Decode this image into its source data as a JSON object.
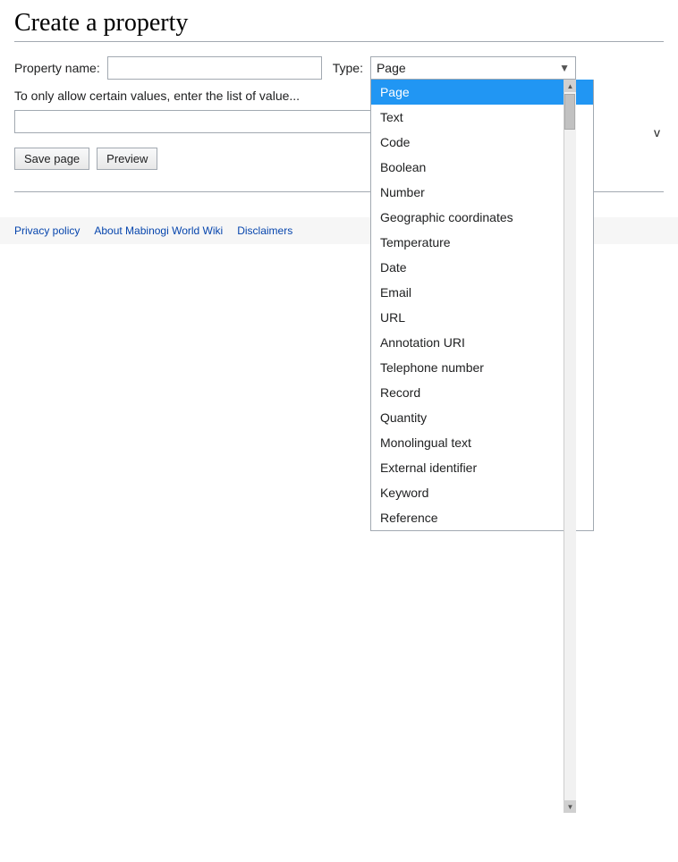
{
  "page": {
    "title": "Create a property"
  },
  "form": {
    "property_name_label": "Property name:",
    "property_name_placeholder": "",
    "type_label": "Type:",
    "selected_type": "Page",
    "allow_values_text": "To only allow certain values, enter the list of value",
    "values_input_placeholder": ""
  },
  "buttons": {
    "save_label": "Save page",
    "preview_label": "Preview"
  },
  "dropdown": {
    "options": [
      {
        "value": "Page",
        "label": "Page",
        "selected": true
      },
      {
        "value": "Text",
        "label": "Text",
        "selected": false
      },
      {
        "value": "Code",
        "label": "Code",
        "selected": false
      },
      {
        "value": "Boolean",
        "label": "Boolean",
        "selected": false
      },
      {
        "value": "Number",
        "label": "Number",
        "selected": false
      },
      {
        "value": "Geographic coordinates",
        "label": "Geographic coordinates",
        "selected": false
      },
      {
        "value": "Temperature",
        "label": "Temperature",
        "selected": false
      },
      {
        "value": "Date",
        "label": "Date",
        "selected": false
      },
      {
        "value": "Email",
        "label": "Email",
        "selected": false
      },
      {
        "value": "URL",
        "label": "URL",
        "selected": false
      },
      {
        "value": "Annotation URI",
        "label": "Annotation URI",
        "selected": false
      },
      {
        "value": "Telephone number",
        "label": "Telephone number",
        "selected": false
      },
      {
        "value": "Record",
        "label": "Record",
        "selected": false
      },
      {
        "value": "Quantity",
        "label": "Quantity",
        "selected": false
      },
      {
        "value": "Monolingual text",
        "label": "Monolingual text",
        "selected": false
      },
      {
        "value": "External identifier",
        "label": "External identifier",
        "selected": false
      },
      {
        "value": "Keyword",
        "label": "Keyword",
        "selected": false
      },
      {
        "value": "Reference",
        "label": "Reference",
        "selected": false
      }
    ]
  },
  "footer": {
    "links": [
      {
        "label": "Privacy policy",
        "href": "#"
      },
      {
        "label": "About Mabinogi World Wiki",
        "href": "#"
      },
      {
        "label": "Disclaimers",
        "href": "#"
      }
    ]
  },
  "scrollbar": {
    "up_arrow": "▲",
    "down_arrow": "▼"
  }
}
